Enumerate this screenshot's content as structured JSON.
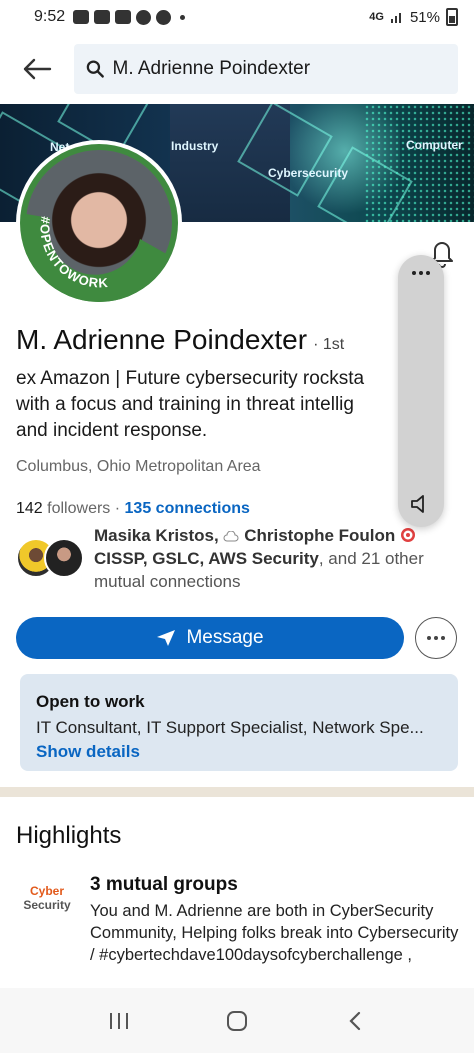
{
  "status_bar": {
    "time": "9:52",
    "network": "4G",
    "battery": "51%"
  },
  "search": {
    "value": "M. Adrienne Poindexter"
  },
  "banner": {
    "labels": [
      "Net",
      "Industry",
      "Cybersecurity",
      "Computer"
    ]
  },
  "profile": {
    "open_to_work_badge": "#OPENTOWORK",
    "name": "M. Adrienne Poindexter",
    "degree": "· 1st",
    "headline_lines": [
      "ex Amazon | Future cybersecurity rocksta",
      "with a focus and training in threat intellig",
      "and incident response."
    ],
    "location": "Columbus, Ohio Metropolitan Area",
    "followers": "142",
    "followers_label": "followers",
    "separator": "·",
    "connections": "135 connections"
  },
  "mutual": {
    "name1": "Masika Kristos,",
    "name2": "Christophe Foulon",
    "certs": "CISSP, GSLC, AWS Security",
    "rest": ", and 21 other mutual connections"
  },
  "actions": {
    "message_label": "Message"
  },
  "open_to_work": {
    "title": "Open to work",
    "roles": "IT Consultant, IT Support Specialist, Network Spe...",
    "show_details": "Show details"
  },
  "highlights": {
    "title": "Highlights",
    "logo_line1": "Cyber",
    "logo_line2": "Security",
    "heading": "3 mutual groups",
    "body": "You and M. Adrienne are both in CyberSecurity Community, Helping folks break into Cybersecurity / #cybertechdave100daysofcyberchallenge ,"
  },
  "colors": {
    "accent": "#0a66c2",
    "open_to_work_green": "#3f8a3f",
    "card_bg": "#dde7f1"
  },
  "icons": {
    "back": "arrow-left-icon",
    "search": "search-icon",
    "bell": "bell-icon",
    "send": "paper-plane-icon",
    "more": "ellipsis-icon",
    "volume": "speaker-icon"
  }
}
